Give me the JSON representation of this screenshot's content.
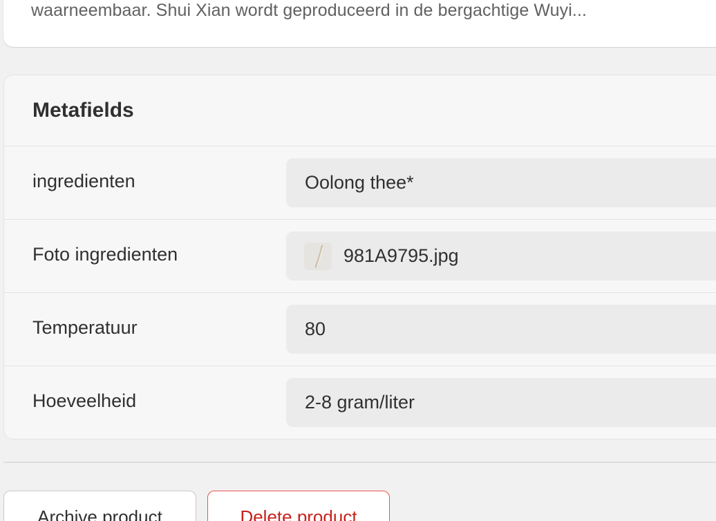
{
  "description": {
    "text": "waarneembaar. Shui Xian wordt geproduceerd in de bergachtige Wuyi..."
  },
  "metafields": {
    "title": "Metafields",
    "rows": [
      {
        "label": "ingredienten",
        "value": "Oolong thee*"
      },
      {
        "label": "Foto ingredienten",
        "value": "981A9795.jpg",
        "icon": "image-thumbnail-icon"
      },
      {
        "label": "Temperatuur",
        "value": "80"
      },
      {
        "label": "Hoeveelheid",
        "value": "2-8 gram/liter"
      }
    ]
  },
  "actions": {
    "archive_label": "Archive product",
    "delete_label": "Delete product",
    "delete_color": "#c7221a"
  }
}
